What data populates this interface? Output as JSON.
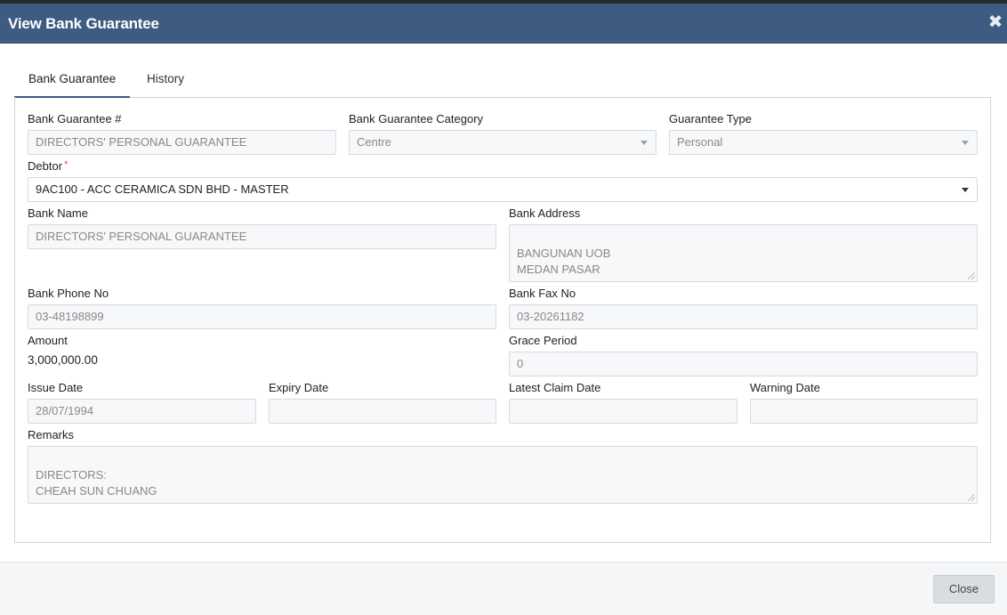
{
  "modal": {
    "title": "View Bank Guarantee",
    "close_icon": "close-icon"
  },
  "tabs": [
    {
      "label": "Bank Guarantee",
      "active": true
    },
    {
      "label": "History",
      "active": false
    }
  ],
  "form": {
    "bg_number": {
      "label": "Bank Guarantee #",
      "value": "DIRECTORS' PERSONAL GUARANTEE"
    },
    "bg_category": {
      "label": "Bank Guarantee Category",
      "value": "Centre"
    },
    "guarantee_type": {
      "label": "Guarantee Type",
      "value": "Personal"
    },
    "debtor": {
      "label": "Debtor",
      "required_mark": "*",
      "value": "9AC100 - ACC CERAMICA SDN BHD - MASTER"
    },
    "bank_name": {
      "label": "Bank Name",
      "value": "DIRECTORS' PERSONAL GUARANTEE"
    },
    "bank_address": {
      "label": "Bank Address",
      "value": "BANGUNAN UOB\nMEDAN PASAR\nKUALA LUMPUR"
    },
    "bank_phone": {
      "label": "Bank Phone No",
      "value": "03-48198899"
    },
    "bank_fax": {
      "label": "Bank Fax No",
      "value": "03-20261182"
    },
    "amount": {
      "label": "Amount",
      "value": "3,000,000.00"
    },
    "grace_period": {
      "label": "Grace Period",
      "value": "0"
    },
    "issue_date": {
      "label": "Issue Date",
      "value": "28/07/1994"
    },
    "expiry_date": {
      "label": "Expiry Date",
      "value": ""
    },
    "latest_claim_date": {
      "label": "Latest Claim Date",
      "value": ""
    },
    "warning_date": {
      "label": "Warning Date",
      "value": ""
    },
    "remarks": {
      "label": "Remarks",
      "value": "DIRECTORS:\nCHEAH SUN CHUANG"
    }
  },
  "footer": {
    "close_label": "Close"
  },
  "colors": {
    "header_bg": "#3e5b82",
    "required": "#d9534f"
  }
}
